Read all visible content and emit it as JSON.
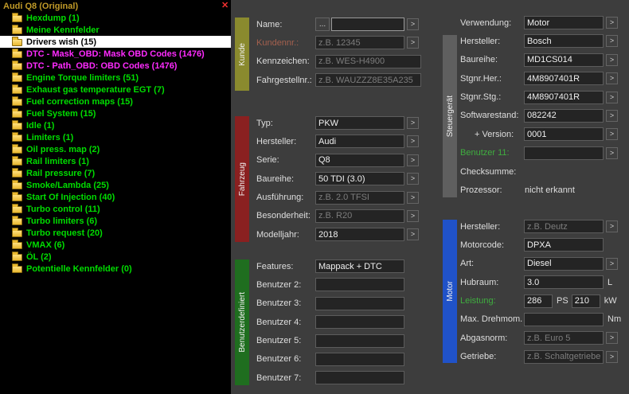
{
  "icons": {
    "close": "✕",
    "arrow": ">",
    "dots": "...",
    "folder": "folder-icon"
  },
  "tree": {
    "title": "Audi Q8 (Original)",
    "title_color": "#c09a28",
    "items": [
      {
        "label": "Hexdump (1)",
        "color": "#00dd00"
      },
      {
        "label": "Meine Kennfelder",
        "color": "#00dd00"
      },
      {
        "label": "Drivers wish (15)",
        "color": "#000000",
        "selected": true
      },
      {
        "label": "DTC - Mask_OBD: Mask OBD Codes (1476)",
        "color": "#ff2bff"
      },
      {
        "label": "DTC - Path_OBD: OBD Codes (1476)",
        "color": "#ff2bff"
      },
      {
        "label": "Engine Torque limiters (51)",
        "color": "#00dd00"
      },
      {
        "label": "Exhaust gas temperature EGT (7)",
        "color": "#00dd00"
      },
      {
        "label": "Fuel correction maps (15)",
        "color": "#00dd00"
      },
      {
        "label": "Fuel System (15)",
        "color": "#00dd00"
      },
      {
        "label": "Idle (1)",
        "color": "#00dd00"
      },
      {
        "label": "Limiters (1)",
        "color": "#00dd00"
      },
      {
        "label": "Oil press. map (2)",
        "color": "#00dd00"
      },
      {
        "label": "Rail limiters (1)",
        "color": "#00dd00"
      },
      {
        "label": "Rail pressure (7)",
        "color": "#00dd00"
      },
      {
        "label": "Smoke/Lambda (25)",
        "color": "#00dd00"
      },
      {
        "label": "Start Of Injection (40)",
        "color": "#00dd00"
      },
      {
        "label": "Turbo control (11)",
        "color": "#00dd00"
      },
      {
        "label": "Turbo limiters (6)",
        "color": "#00dd00"
      },
      {
        "label": "Turbo request (20)",
        "color": "#00dd00"
      },
      {
        "label": "VMAX (6)",
        "color": "#00dd00"
      },
      {
        "label": "ÖL (2)",
        "color": "#00dd00"
      },
      {
        "label": "Potentielle Kennfelder (0)",
        "color": "#00dd00"
      }
    ]
  },
  "groups": [
    {
      "id": "kunde",
      "title": "Kunde",
      "color": "#8a8a2e",
      "rows": [
        {
          "label": "Name:",
          "dots": true,
          "value": "",
          "short": true,
          "focused": true,
          "arrow": true
        },
        {
          "label": "Kundennr.:",
          "label_color": "#a4604e",
          "placeholder": "z.B. 12345",
          "arrow": true
        },
        {
          "label": "Kennzeichen:",
          "placeholder": "z.B. WES-H4900",
          "wide": true
        },
        {
          "label": "Fahrgestellnr.:",
          "placeholder": "z.B. WAUZZZ8E35A235",
          "wide": true
        }
      ]
    },
    {
      "id": "fahrzeug",
      "title": "Fahrzeug",
      "color": "#8a2020",
      "rows": [
        {
          "label": "Typ:",
          "value": "PKW",
          "arrow": true
        },
        {
          "label": "Hersteller:",
          "value": "Audi",
          "arrow": true
        },
        {
          "label": "Serie:",
          "value": "Q8",
          "arrow": true
        },
        {
          "label": "Baureihe:",
          "value": "50 TDI (3.0)",
          "arrow": true
        },
        {
          "label": "Ausführung:",
          "placeholder": "z.B. 2.0 TFSI",
          "arrow": true
        },
        {
          "label": "Besonderheit:",
          "placeholder": "z.B. R20",
          "arrow": true
        },
        {
          "label": "Modelljahr:",
          "value": "2018",
          "arrow": true
        }
      ]
    },
    {
      "id": "benutzer",
      "title": "Benutzerdefiniert",
      "color": "#1f6e1f",
      "rows": [
        {
          "label": "Features:",
          "value": "Mappack + DTC"
        },
        {
          "label": "Benutzer 2:",
          "value": ""
        },
        {
          "label": "Benutzer 3:",
          "value": ""
        },
        {
          "label": "Benutzer 4:",
          "value": ""
        },
        {
          "label": "Benutzer 5:",
          "value": ""
        },
        {
          "label": "Benutzer 6:",
          "value": ""
        },
        {
          "label": "Benutzer 7:",
          "value": ""
        }
      ]
    },
    {
      "id": "steuer",
      "title": "Steuergerät",
      "color": "#5f5f5f",
      "rows": [
        {
          "label": "Verwendung:",
          "value": "Motor",
          "arrow": true
        },
        {
          "label": "Hersteller:",
          "value": "Bosch",
          "arrow": true
        },
        {
          "label": "Baureihe:",
          "value": "MD1CS014",
          "arrow": true
        },
        {
          "label": "Stgnr.Her.:",
          "value": "4M8907401R",
          "arrow": true
        },
        {
          "label": "Stgnr.Stg.:",
          "value": "4M8907401R",
          "arrow": true
        },
        {
          "label": "Softwarestand:",
          "value": "082242",
          "arrow": true
        },
        {
          "label": "+ Version:",
          "value": "0001",
          "arrow": true,
          "indent": true
        },
        {
          "label": "Benutzer 11:",
          "label_color": "#3fae3f",
          "value": "",
          "arrow": true
        },
        {
          "label": "Checksumme:",
          "static_text": ""
        },
        {
          "label": "Prozessor:",
          "static_text": "nicht erkannt"
        }
      ]
    },
    {
      "id": "motor",
      "title": "Motor",
      "color": "#2052c8",
      "rows": [
        {
          "label": "Hersteller:",
          "placeholder": "z.B. Deutz",
          "arrow": true
        },
        {
          "label": "Motorcode:",
          "value": "DPXA"
        },
        {
          "label": "Art:",
          "value": "Diesel",
          "arrow": true
        },
        {
          "label": "Hubraum:",
          "value": "3.0",
          "suffix": "L"
        },
        {
          "label": "Leistung:",
          "label_color": "#3fae3f",
          "value": "286",
          "suffix": "PS",
          "value2": "210",
          "suffix2": "kW"
        },
        {
          "label": "Max. Drehmom.",
          "value": "",
          "suffix": "Nm"
        },
        {
          "label": "Abgasnorm:",
          "placeholder": "z.B. Euro 5",
          "arrow": true
        },
        {
          "label": "Getriebe:",
          "placeholder": "z.B. Schaltgetriebe",
          "arrow": true
        }
      ]
    }
  ]
}
